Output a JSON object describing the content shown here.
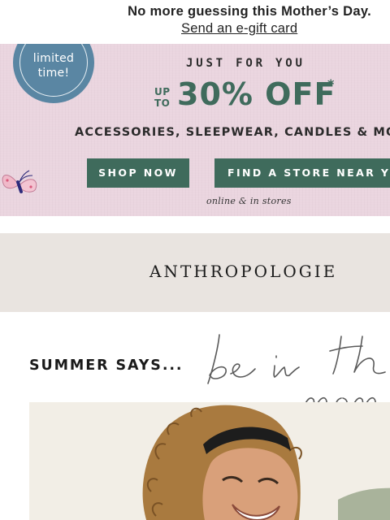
{
  "announcement": {
    "headline": "No more guessing this Mother’s Day.",
    "link": "Send an e-gift card"
  },
  "promo": {
    "badge": "limited time!",
    "eyebrow": "JUST FOR YOU",
    "up_to": "UP TO",
    "discount": "30% OFF",
    "asterisk": "*",
    "categories": "ACCESSORIES, SLEEPWEAR, CANDLES & MO",
    "shop_button": "SHOP NOW",
    "find_button": "FIND A STORE NEAR YOU",
    "availability": "online & in stores",
    "colors": {
      "background": "#ead5df",
      "accent": "#3f6b5c",
      "badge": "#5a86a3"
    }
  },
  "brand": {
    "name": "ANTHROPOLOGIE"
  },
  "summer": {
    "heading": "SUMMER SAYS...",
    "script_text": "be in th mom",
    "photo_icon": "woman-smiling-photo"
  }
}
